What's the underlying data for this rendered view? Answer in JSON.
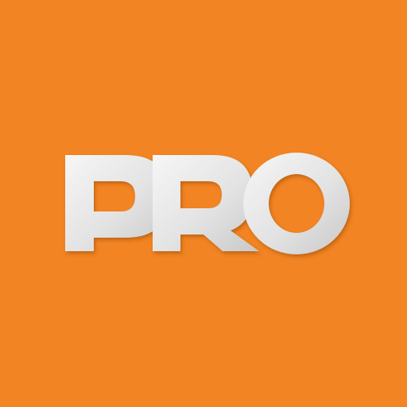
{
  "icon": {
    "name": "pro-app-icon",
    "logo_text": "PRO",
    "colors": {
      "background": "#F28423",
      "letter_light": "#F4F4F4",
      "letter_dark": "#CDCDCD",
      "shadow": "#9A4A0E"
    }
  }
}
